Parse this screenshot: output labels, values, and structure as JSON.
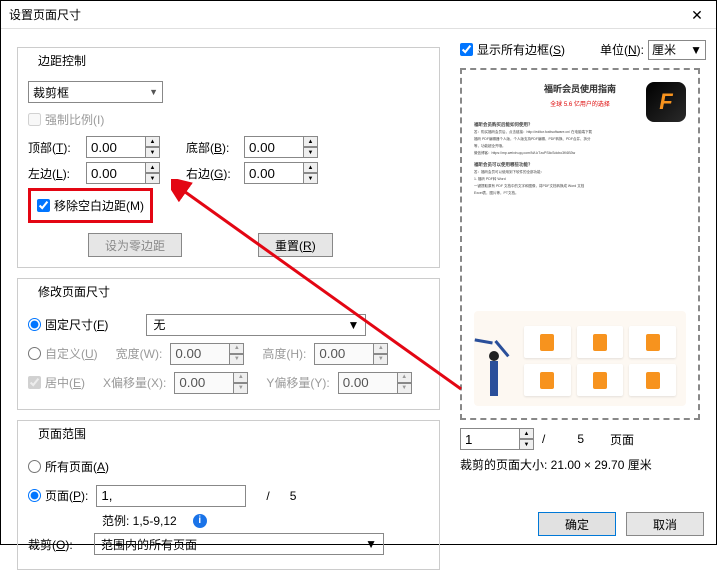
{
  "title": "设置页面尺寸",
  "section_margins": {
    "title": "边距控制",
    "crop_select": "裁剪框",
    "force_ratio": "强制比例(I)",
    "top_label_pre": "顶部(",
    "top_label_accel": "T",
    "top_label_post": "):",
    "bottom_label_pre": "底部(",
    "bottom_label_accel": "B",
    "bottom_label_post": "):",
    "left_label_pre": "左边(",
    "left_label_accel": "L",
    "left_label_post": "):",
    "right_label_pre": "右边(",
    "right_label_accel": "G",
    "right_label_post": "):",
    "top_val": "0.00",
    "bottom_val": "0.00",
    "left_val": "0.00",
    "right_val": "0.00",
    "remove_whitespace": "移除空白边距(M)",
    "zero_margin_btn": "设为零边距",
    "reset_btn_pre": "重置(",
    "reset_btn_accel": "R",
    "reset_btn_post": ")"
  },
  "section_modify": {
    "title": "修改页面尺寸",
    "fixed_pre": "固定尺寸(",
    "fixed_accel": "F",
    "fixed_post": ")",
    "fixed_value": "无",
    "custom_pre": "自定义(",
    "custom_accel": "U",
    "custom_post": ")",
    "width_label": "宽度(W):",
    "width_val": "0.00",
    "height_label": "高度(H):",
    "height_val": "0.00",
    "center_pre": "居中(",
    "center_accel": "E",
    "center_post": ")",
    "xoffset_label": "X偏移量(X):",
    "xoffset_val": "0.00",
    "yoffset_label": "Y偏移量(Y):",
    "yoffset_val": "0.00"
  },
  "section_range": {
    "title": "页面范围",
    "all_pages_pre": "所有页面(",
    "all_pages_accel": "A",
    "all_pages_post": ")",
    "page_pre": "页面(",
    "page_accel": "P",
    "page_post": "):",
    "page_val": "1,",
    "total_pages": "5",
    "range_example": "范例: 1,5-9,12",
    "crop_label_pre": "裁剪(",
    "crop_label_accel": "O",
    "crop_label_post": "):",
    "crop_value": "范围内的所有页面"
  },
  "right": {
    "show_all_pre": "显示所有边框(",
    "show_all_accel": "S",
    "show_all_post": ")",
    "unit_label_pre": "单位(",
    "unit_label_accel": "N",
    "unit_label_post": "):",
    "unit_value": "厘米",
    "preview_title": "福昕会员使用指南",
    "preview_sub": "全球 5.6 亿用户的选择",
    "nav_page": "1",
    "nav_total": "5",
    "nav_unit": "页面",
    "crop_size": "裁剪的页面大小: 21.00 × 29.70 厘米"
  },
  "footer": {
    "ok": "确定",
    "cancel": "取消"
  }
}
